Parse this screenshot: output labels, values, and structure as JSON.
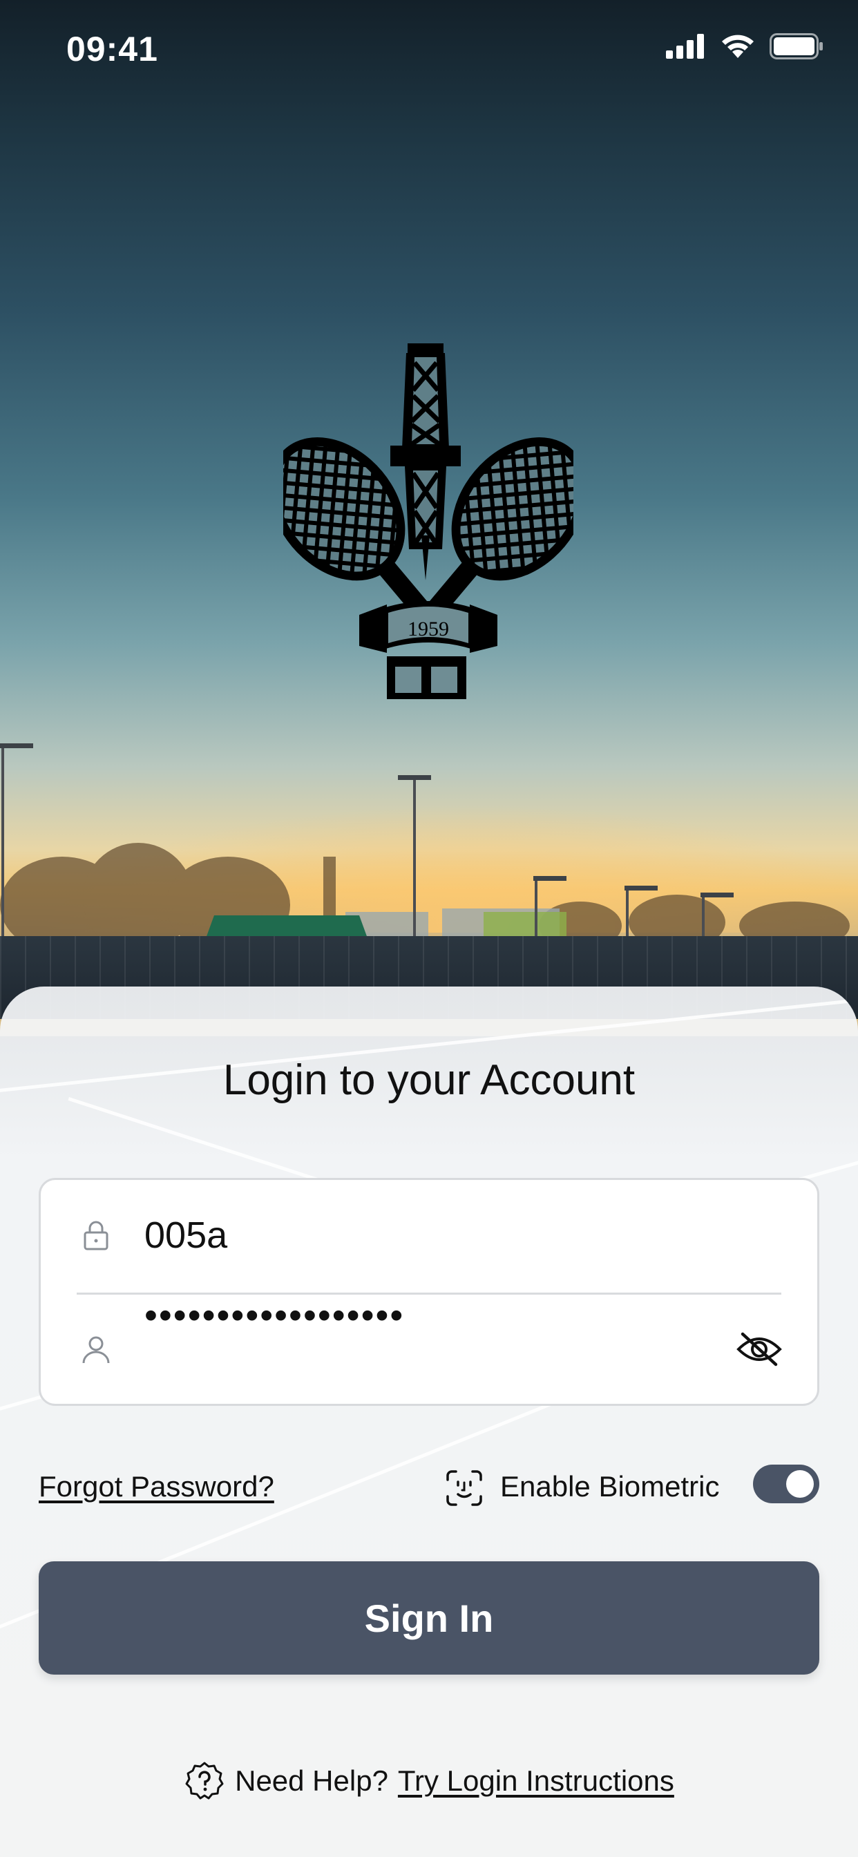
{
  "status_bar": {
    "time": "09:41",
    "icons": [
      "cellular-signal-icon",
      "wifi-icon",
      "battery-icon"
    ]
  },
  "logo": {
    "year": "1959",
    "description_icon": "club-crest-logo"
  },
  "login": {
    "title": "Login to your Account",
    "username_value": "005a",
    "username_icon": "lock-icon",
    "password_value": "••••••••••••••••••",
    "password_icon": "user-icon",
    "password_toggle_icon": "eye-off-icon"
  },
  "options": {
    "forgot_password": "Forgot Password?",
    "biometric_label": "Enable Biometric",
    "biometric_icon": "face-id-icon",
    "biometric_enabled": true
  },
  "actions": {
    "sign_in": "Sign In"
  },
  "help": {
    "prefix": "Need Help?",
    "link": "Try Login Instructions",
    "icon": "help-question-icon"
  },
  "colors": {
    "primary_button": "#4a5466",
    "toggle_on": "#4a5466",
    "text": "#111111",
    "card_background": "#f2f4f6"
  }
}
